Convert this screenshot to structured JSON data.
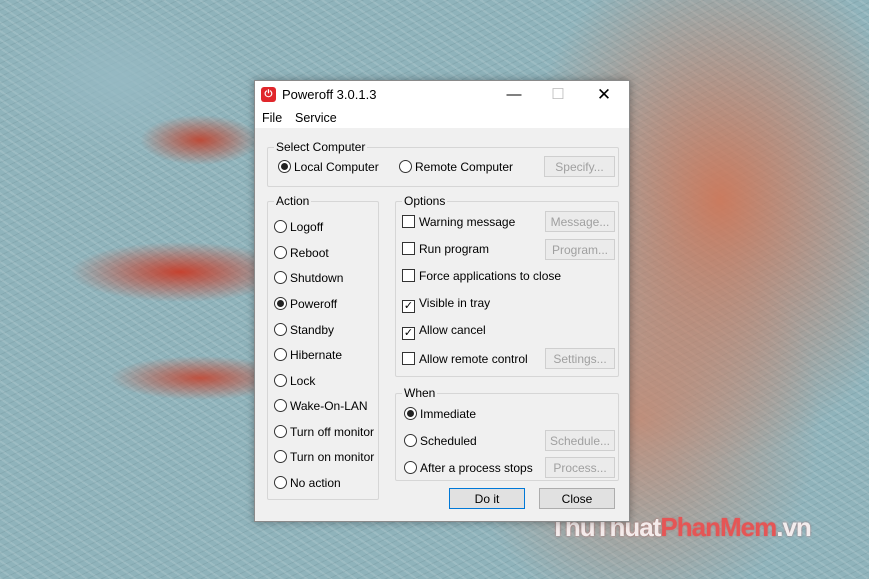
{
  "window": {
    "title": "Poweroff 3.0.1.3",
    "icon": "power-icon",
    "minimize_glyph": "—",
    "maximize_glyph": "☐",
    "close_glyph": "✕",
    "accent_color": "#e0262b"
  },
  "menu": [
    "File",
    "Service"
  ],
  "select_computer": {
    "label": "Select Computer",
    "local": "Local Computer",
    "remote": "Remote Computer",
    "specify": "Specify...",
    "selected": "local"
  },
  "action": {
    "label": "Action",
    "options": [
      "Logoff",
      "Reboot",
      "Shutdown",
      "Poweroff",
      "Standby",
      "Hibernate",
      "Lock",
      "Wake-On-LAN",
      "Turn off monitor",
      "Turn on monitor",
      "No action"
    ],
    "selected": "Poweroff"
  },
  "options": {
    "label": "Options",
    "items": [
      {
        "label": "Warning message",
        "checked": false,
        "button": "Message..."
      },
      {
        "label": "Run program",
        "checked": false,
        "button": "Program..."
      },
      {
        "label": "Force applications to close",
        "checked": false
      },
      {
        "label": "Visible in tray",
        "checked": true
      },
      {
        "label": "Allow cancel",
        "checked": true
      },
      {
        "label": "Allow remote control",
        "checked": false,
        "button": "Settings..."
      }
    ]
  },
  "when": {
    "label": "When",
    "options": [
      {
        "label": "Immediate"
      },
      {
        "label": "Scheduled",
        "button": "Schedule..."
      },
      {
        "label": "After a process stops",
        "button": "Process..."
      }
    ],
    "selected": "Immediate"
  },
  "buttons": {
    "doit": "Do it",
    "close": "Close"
  },
  "watermark": {
    "part1": "ThuThuat",
    "part2": "PhanMem",
    "part3": ".vn"
  }
}
